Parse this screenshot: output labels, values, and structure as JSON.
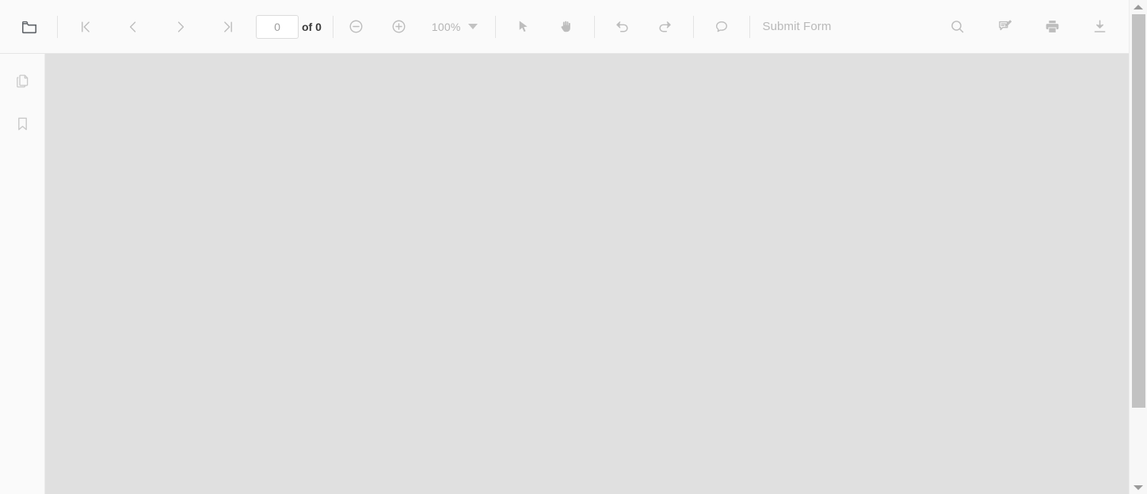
{
  "app": {
    "name": "pdf-viewer",
    "colors": {
      "toolbar_bg": "#fafafa",
      "document_bg": "#e0e0e0",
      "icon_light": "#bdbdbd",
      "icon_dark": "#5f6368",
      "text_dark": "#3c3c3c",
      "text_light": "#b9b9b9",
      "scrollbar_thumb": "#c2c2c2"
    }
  },
  "toolbar": {
    "open_file": {
      "icon": "folder-icon",
      "label": "Open File"
    },
    "navigation": {
      "first_page": {
        "icon": "first-page-icon",
        "label": "First Page"
      },
      "previous_page": {
        "icon": "chevron-left-icon",
        "label": "Previous Page"
      },
      "next_page": {
        "icon": "chevron-right-icon",
        "label": "Next Page"
      },
      "last_page": {
        "icon": "last-page-icon",
        "label": "Last Page"
      }
    },
    "page_number": {
      "value": "0",
      "placeholder": "0",
      "total_label": "of 0"
    },
    "zoom": {
      "zoom_out": {
        "icon": "zoom-out-icon",
        "label": "Zoom Out"
      },
      "zoom_in": {
        "icon": "zoom-in-icon",
        "label": "Zoom In"
      },
      "level": "100%",
      "dropdown_icon": "chevron-down-icon"
    },
    "tools": {
      "select": {
        "icon": "cursor-arrow-icon",
        "label": "Select Tool"
      },
      "pan": {
        "icon": "hand-icon",
        "label": "Pan Tool"
      }
    },
    "history": {
      "undo": {
        "icon": "undo-icon",
        "label": "Undo"
      },
      "redo": {
        "icon": "redo-icon",
        "label": "Redo"
      }
    },
    "comment": {
      "icon": "comment-bubble-icon",
      "label": "Comment"
    },
    "submit_form": "Submit Form",
    "actions": {
      "search": {
        "icon": "search-icon",
        "label": "Search"
      },
      "annotate": {
        "icon": "annotate-edit-icon",
        "label": "Annotate"
      },
      "print": {
        "icon": "print-icon",
        "label": "Print"
      },
      "download": {
        "icon": "download-icon",
        "label": "Download"
      }
    }
  },
  "sidebar": {
    "items": [
      {
        "icon": "page-thumbnails-icon",
        "label": "Page Thumbnails"
      },
      {
        "icon": "bookmark-icon",
        "label": "Bookmarks"
      }
    ]
  },
  "document": {
    "content": "",
    "empty": true
  },
  "scrollbar": {
    "up_arrow": "scroll-up-icon",
    "down_arrow": "scroll-down-icon",
    "thumb_position_percent": 0,
    "thumb_size_percent": 80
  }
}
